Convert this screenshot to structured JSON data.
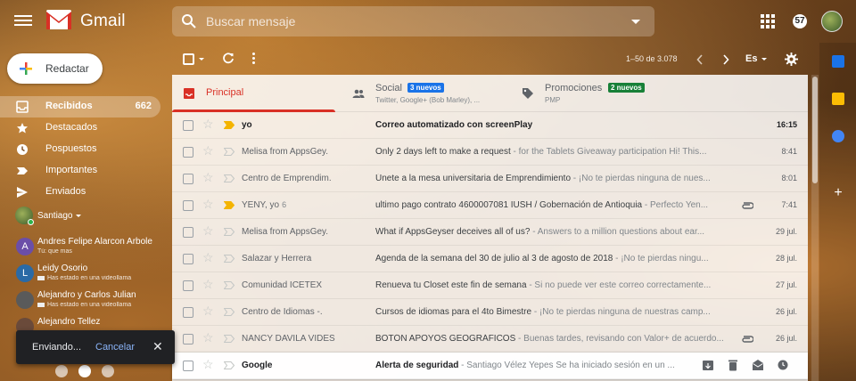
{
  "header": {
    "logo_text": "Gmail",
    "search_placeholder": "Buscar mensaje",
    "notifications": "57"
  },
  "sidebar": {
    "compose_label": "Redactar",
    "items": [
      {
        "label": "Recibidos",
        "count": "662",
        "icon": "inbox-icon"
      },
      {
        "label": "Destacados",
        "icon": "star-icon"
      },
      {
        "label": "Pospuestos",
        "icon": "clock-icon"
      },
      {
        "label": "Importantes",
        "icon": "label-important-icon"
      },
      {
        "label": "Enviados",
        "icon": "send-icon"
      }
    ],
    "user": {
      "name": "Santiago"
    },
    "contacts": [
      {
        "initial": "A",
        "name": "Andres Felipe Alarcon Arbole",
        "status": "Tú: que mas",
        "color": "#6b4ea8"
      },
      {
        "initial": "L",
        "name": "Leidy Osorio",
        "status": "Has estado en una videollama",
        "color": "#2a6aa6"
      },
      {
        "initial": "",
        "name": "Alejandro y Carlos Julian",
        "status": "Has estado en una videollama",
        "color": "#5a5a5a"
      },
      {
        "initial": "",
        "name": "Alejandro Tellez",
        "status": "",
        "color": "#6a4a3a"
      }
    ]
  },
  "toolbar": {
    "pager": "1–50 de 3.078",
    "lang": "Es"
  },
  "tabs": [
    {
      "name": "Principal",
      "sub": "",
      "badge": ""
    },
    {
      "name": "Social",
      "sub": "Twitter, Google+ (Bob Marley), ...",
      "badge": "3 nuevos",
      "badge_color": "#1a73e8"
    },
    {
      "name": "Promociones",
      "sub": "PMP",
      "badge": "2 nuevos",
      "badge_color": "#188038"
    }
  ],
  "emails": [
    {
      "sender": "yo",
      "count": "",
      "subject": "Correo automatizado con screenPlay",
      "preview": "",
      "date": "16:15",
      "unread": true,
      "important": true,
      "attachment": false
    },
    {
      "sender": "Melisa from AppsGey.",
      "count": "",
      "subject": "Only 2 days left to make a request",
      "preview": " - for the Tablets Giveaway participation Hi! This...",
      "date": "8:41",
      "unread": false,
      "important": false,
      "attachment": false
    },
    {
      "sender": "Centro de Emprendim.",
      "count": "",
      "subject": "Únete a la mesa universitaria de Emprendimiento",
      "preview": " - ¡No te pierdas ninguna de nues...",
      "date": "8:01",
      "unread": false,
      "important": false,
      "attachment": false
    },
    {
      "sender": "YENY, yo",
      "count": "6",
      "subject": "ultimo pago contrato 4600007081 IUSH / Gobernación de Antioquia",
      "preview": " - Perfecto Yen...",
      "date": "7:41",
      "unread": false,
      "important": true,
      "attachment": true
    },
    {
      "sender": "Melisa from AppsGey.",
      "count": "",
      "subject": "What if AppsGeyser deceives all of us?",
      "preview": " - Answers to a million questions about ear...",
      "date": "29 jul.",
      "unread": false,
      "important": false,
      "attachment": false
    },
    {
      "sender": "Salazar y Herrera",
      "count": "",
      "subject": "Agenda de la semana del 30 de julio al 3 de agosto de 2018",
      "preview": " - ¡No te pierdas ningu...",
      "date": "28 jul.",
      "unread": false,
      "important": false,
      "attachment": false
    },
    {
      "sender": "Comunidad ICETEX",
      "count": "",
      "subject": "Renueva tu Closet este fin de semana",
      "preview": " - Si no puede ver este correo correctamente...",
      "date": "27 jul.",
      "unread": false,
      "important": false,
      "attachment": false
    },
    {
      "sender": "Centro de Idiomas -.",
      "count": "",
      "subject": "Cursos de idiomas para el 4to Bimestre",
      "preview": " - ¡No te pierdas ninguna de nuestras camp...",
      "date": "26 jul.",
      "unread": false,
      "important": false,
      "attachment": false
    },
    {
      "sender": "NANCY DAVILA VIDES",
      "count": "",
      "subject": "BOTÓN APOYOS GEOGRÁFICOS",
      "preview": " - Buenas tardes, revisando con Valor+ de acuerdo...",
      "date": "26 jul.",
      "unread": false,
      "important": false,
      "attachment": true
    },
    {
      "sender": "Google",
      "count": "",
      "subject": "Alerta de seguridad",
      "preview": " - Santiago Vélez Yepes Se ha iniciado sesión en un ...",
      "date": "",
      "unread": true,
      "important": false,
      "attachment": false,
      "hover": true
    }
  ],
  "toast": {
    "message": "Enviando...",
    "undo": "Cancelar"
  },
  "colors": {
    "accent_red": "#d93025",
    "important_yellow": "#f4b400"
  }
}
